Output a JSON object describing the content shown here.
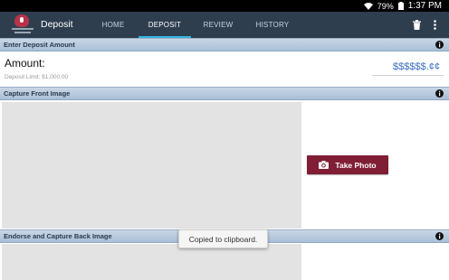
{
  "status_bar": {
    "battery": "79%",
    "time": "1:37 PM",
    "icons": [
      "wifi-icon",
      "battery-icon"
    ]
  },
  "app_bar": {
    "title": "Deposit",
    "logo_icon": "bank-logo",
    "tabs": [
      {
        "label": "HOME",
        "active": false
      },
      {
        "label": "DEPOSIT",
        "active": true
      },
      {
        "label": "REVIEW",
        "active": false
      },
      {
        "label": "HISTORY",
        "active": false
      }
    ],
    "actions": [
      "trash-icon",
      "overflow-menu-icon"
    ],
    "accent_color": "#33b5e5",
    "background_color": "#2f3e4f"
  },
  "sections": {
    "amount": {
      "header": "Enter Deposit Amount",
      "label": "Amount:",
      "limit_text": "Deposit Limit: $1,000.00",
      "placeholder": "$$$$$$.¢¢",
      "value": ""
    },
    "front": {
      "header": "Capture Front Image",
      "button_label": "Take Photo",
      "button_icon": "camera-icon",
      "button_color": "#7f1e35"
    },
    "back": {
      "header": "Endorse and Capture Back Image"
    }
  },
  "toast": {
    "message": "Copied to clipboard."
  }
}
